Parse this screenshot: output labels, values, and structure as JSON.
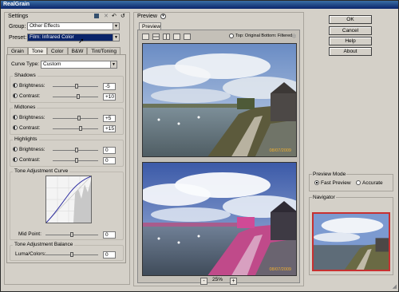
{
  "window": {
    "title": "RealGrain"
  },
  "settings": {
    "header": "Settings",
    "group_label": "Group:",
    "group_value": "Other Effects",
    "preset_label": "Preset:",
    "preset_value": "Film: Infrared Color",
    "tabs": [
      "Grain",
      "Tone",
      "Color",
      "B&W",
      "Tint/Toning"
    ],
    "active_tab": "Tone",
    "curve_type_label": "Curve Type:",
    "curve_type_value": "Custom",
    "shadows": {
      "label": "Shadows",
      "brightness_label": "Brightness:",
      "brightness": "-5",
      "contrast_label": "Contrast:",
      "contrast": "+10"
    },
    "midtones": {
      "label": "Midtones",
      "brightness_label": "Brightness:",
      "brightness": "+5",
      "contrast_label": "Contrast:",
      "contrast": "+15"
    },
    "highlights": {
      "label": "Highlights",
      "brightness_label": "Brightness:",
      "brightness": "0",
      "contrast_label": "Contrast:",
      "contrast": "0"
    },
    "curve_group": {
      "label": "Tone Adjustment Curve",
      "midpoint_label": "Mid Point:",
      "midpoint": "0"
    },
    "balance_group": {
      "label": "Tone Adjustment Balance",
      "luma_label": "Luma/Colors:",
      "luma": "0"
    }
  },
  "preview": {
    "header": "Preview",
    "tab": "Preview 1",
    "split_label": "Top: Original Bottom: Filtered",
    "timestamp": "08/07/2009",
    "zoom": "25%",
    "zoom_minus": "-",
    "zoom_plus": "+"
  },
  "buttons": {
    "ok": "OK",
    "cancel": "Cancel",
    "help": "Help",
    "about": "About"
  },
  "preview_mode": {
    "label": "Preview Mode",
    "fast": "Fast Preview",
    "accurate": "Accurate",
    "selected": "fast"
  },
  "navigator": {
    "label": "Navigator"
  }
}
